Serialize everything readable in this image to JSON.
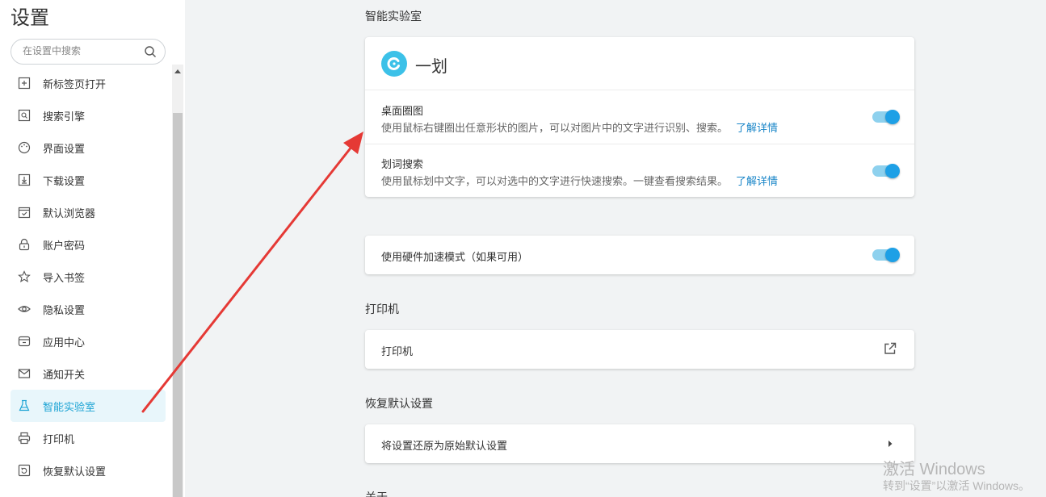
{
  "sidebar": {
    "title": "设置",
    "search_placeholder": "在设置中搜索",
    "items": [
      {
        "label": "新标签页打开",
        "icon": "new-tab-icon"
      },
      {
        "label": "搜索引擎",
        "icon": "search-engine-icon"
      },
      {
        "label": "界面设置",
        "icon": "palette-icon"
      },
      {
        "label": "下载设置",
        "icon": "download-icon"
      },
      {
        "label": "默认浏览器",
        "icon": "browser-icon"
      },
      {
        "label": "账户密码",
        "icon": "lock-icon"
      },
      {
        "label": "导入书签",
        "icon": "star-icon"
      },
      {
        "label": "隐私设置",
        "icon": "eye-icon"
      },
      {
        "label": "应用中心",
        "icon": "app-icon"
      },
      {
        "label": "通知开关",
        "icon": "mail-icon"
      },
      {
        "label": "智能实验室",
        "icon": "flask-icon",
        "active": true
      },
      {
        "label": "打印机",
        "icon": "printer-icon"
      },
      {
        "label": "恢复默认设置",
        "icon": "restore-icon"
      }
    ]
  },
  "lab": {
    "section_title": "智能实验室",
    "app_name": "一划",
    "rows": [
      {
        "title": "桌面圈图",
        "desc": "使用鼠标右键圈出任意形状的图片，可以对图片中的文字进行识别、搜索。",
        "link": "了解详情",
        "enabled": true
      },
      {
        "title": "划词搜索",
        "desc": "使用鼠标划中文字，可以对选中的文字进行快速搜索。一键查看搜索结果。",
        "link": "了解详情",
        "enabled": true
      }
    ]
  },
  "hardware": {
    "label": "使用硬件加速模式（如果可用）",
    "enabled": true
  },
  "printer": {
    "section_title": "打印机",
    "label": "打印机"
  },
  "restore": {
    "section_title": "恢复默认设置",
    "label": "将设置还原为原始默认设置"
  },
  "about": {
    "section_title": "关于"
  },
  "watermark": {
    "line1": "激活 Windows",
    "line2": "转到“设置”以激活 Windows。"
  },
  "colors": {
    "accent": "#1ea0e6",
    "arrow": "#e53935",
    "active_bg": "#e8f6fb"
  }
}
